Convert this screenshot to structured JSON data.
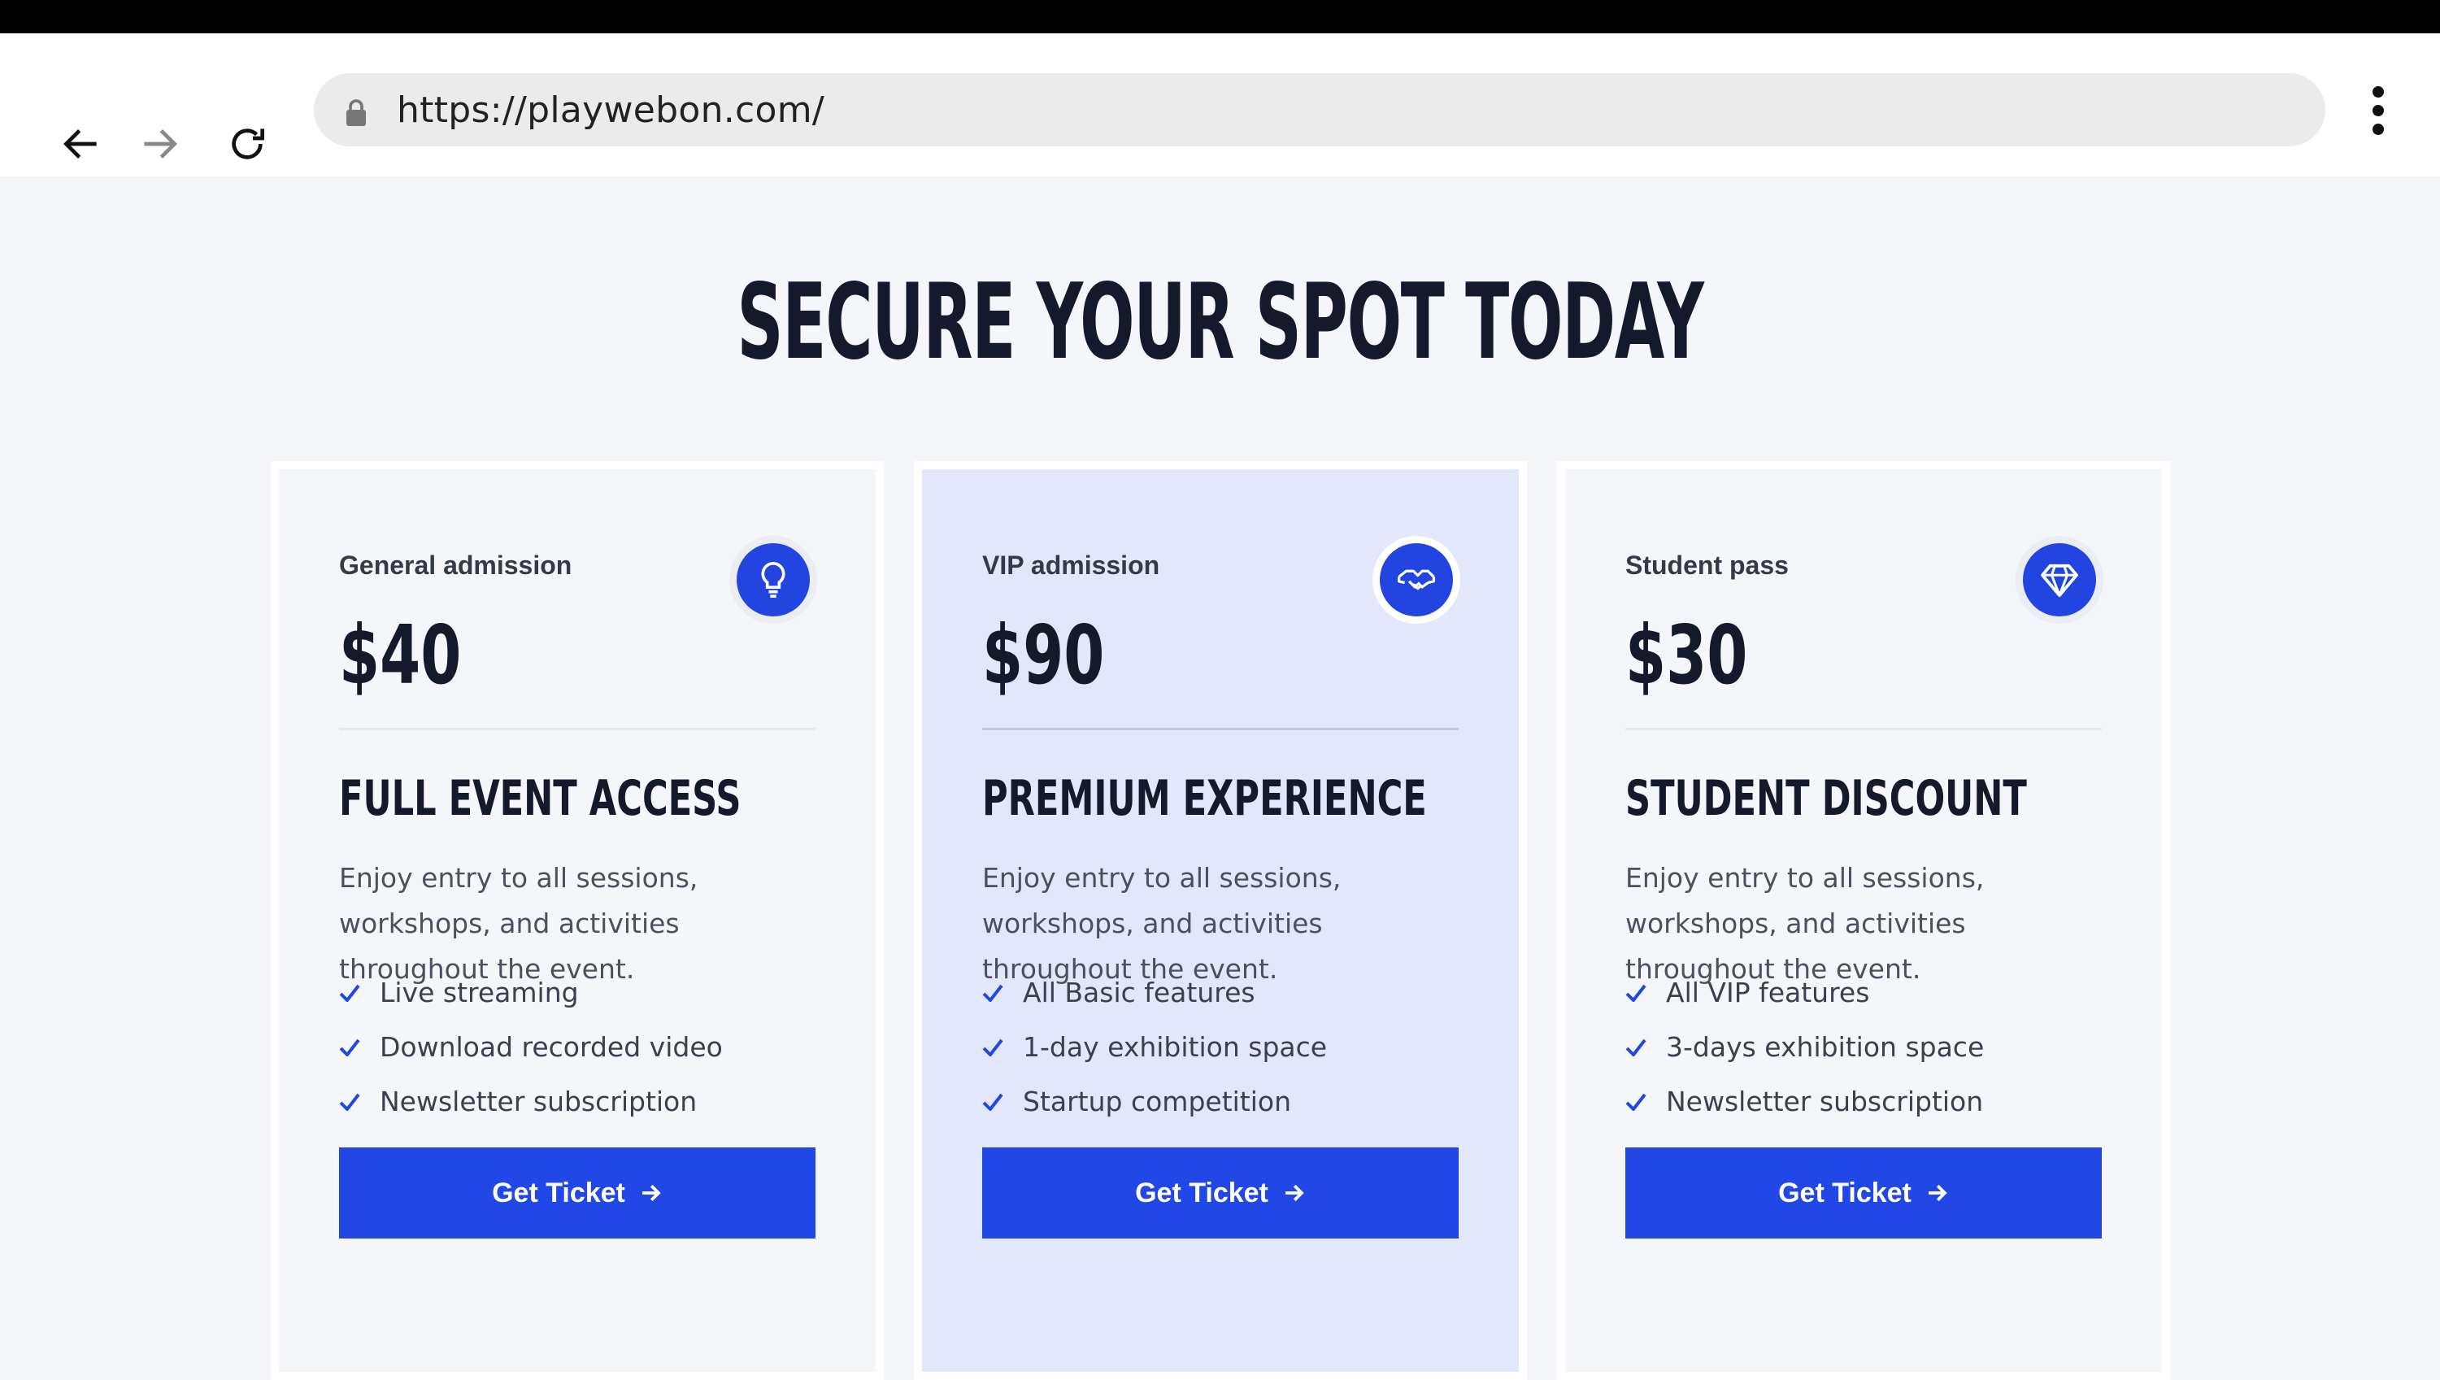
{
  "browser": {
    "url": "https://playwebon.com/",
    "icons": {
      "back": "arrow-left-icon",
      "forward": "arrow-right-icon",
      "reload": "reload-icon",
      "lock": "lock-icon",
      "menu": "more-vert-icon"
    }
  },
  "page": {
    "headline": "SECURE YOUR SPOT TODAY",
    "accent_color": "#2147e6",
    "plans": [
      {
        "name": "General admission",
        "icon": "lightbulb-icon",
        "price": "$40",
        "title": "FULL EVENT ACCESS",
        "description": "Enjoy entry to all sessions, workshops, and activities throughout the event.",
        "features": [
          "Live streaming",
          "Download recorded video",
          "Newsletter subscription"
        ],
        "cta": "Get Ticket"
      },
      {
        "name": "VIP admission",
        "icon": "handshake-icon",
        "price": "$90",
        "title": "PREMIUM EXPERIENCE",
        "description": "Enjoy entry to all sessions, workshops, and activities throughout the event.",
        "features": [
          "All Basic features",
          "1-day exhibition space",
          "Startup competition"
        ],
        "cta": "Get Ticket",
        "highlight_color": "#e3e7fb"
      },
      {
        "name": "Student pass",
        "icon": "diamond-icon",
        "price": "$30",
        "title": "STUDENT DISCOUNT",
        "description": "Enjoy entry to all sessions, workshops, and activities throughout the event.",
        "features": [
          "All VIP features",
          "3-days exhibition space",
          "Newsletter subscription"
        ],
        "cta": "Get Ticket"
      }
    ]
  }
}
